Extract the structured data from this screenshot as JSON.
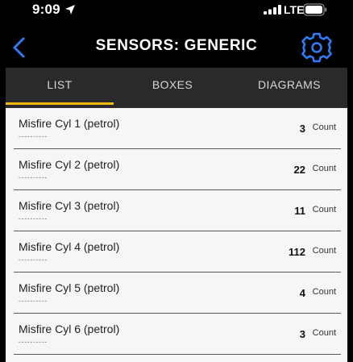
{
  "status_bar": {
    "time": "9:09",
    "network": "LTE",
    "icons": [
      "location-arrow-icon",
      "signal-icon",
      "battery-icon"
    ]
  },
  "header": {
    "title": "SENSORS: GENERIC",
    "back_icon": "chevron-left-icon",
    "settings_icon": "gear-icon"
  },
  "tabs": [
    {
      "label": "LIST",
      "active": true
    },
    {
      "label": "BOXES",
      "active": false
    },
    {
      "label": "DIAGRAMS",
      "active": false
    }
  ],
  "sensors": [
    {
      "name": "Misfire Cyl 1 (petrol)",
      "placeholder": "----------",
      "value": "3",
      "unit": "Count"
    },
    {
      "name": "Misfire Cyl 2 (petrol)",
      "placeholder": "----------",
      "value": "22",
      "unit": "Count"
    },
    {
      "name": "Misfire Cyl 3 (petrol)",
      "placeholder": "----------",
      "value": "11",
      "unit": "Count"
    },
    {
      "name": "Misfire Cyl 4 (petrol)",
      "placeholder": "----------",
      "value": "112",
      "unit": "Count"
    },
    {
      "name": "Misfire Cyl 5 (petrol)",
      "placeholder": "----------",
      "value": "4",
      "unit": "Count"
    },
    {
      "name": "Misfire Cyl 6 (petrol)",
      "placeholder": "----------",
      "value": "3",
      "unit": "Count"
    }
  ],
  "colors": {
    "accent": "#2f7bf6",
    "tab_indicator": "#f0b90e",
    "tab_bar": "#2a2a2c",
    "list_background": "#f6f6f6"
  }
}
